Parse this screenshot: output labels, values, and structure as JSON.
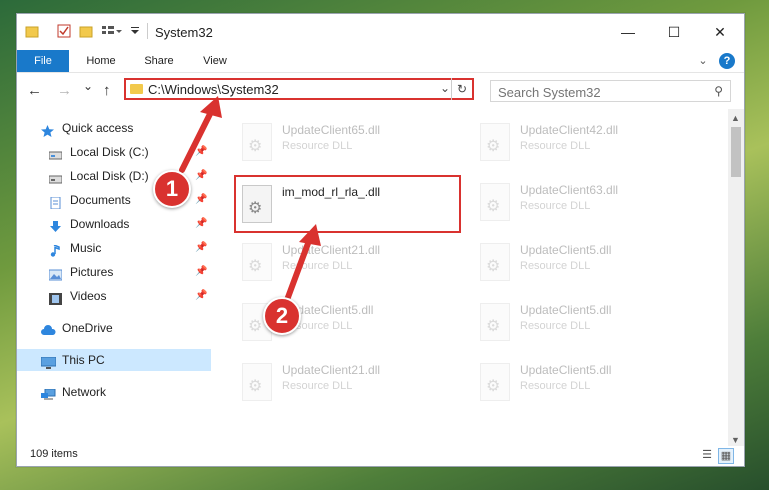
{
  "window": {
    "title": "System32",
    "minimize_glyph": "—",
    "maximize_glyph": "☐",
    "close_glyph": "✕",
    "help_glyph": "?"
  },
  "ribbon": {
    "tabs": [
      {
        "label": "File"
      },
      {
        "label": "Home"
      },
      {
        "label": "Share"
      },
      {
        "label": "View"
      }
    ],
    "expand_glyph": "⌄"
  },
  "nav": {
    "back_glyph": "←",
    "forward_glyph": "→",
    "recent_glyph": "⌄",
    "up_glyph": "↑",
    "address": "C:\\Windows\\System32",
    "address_dropdown_glyph": "⌄",
    "refresh_glyph": "↻",
    "search_placeholder": "Search System32",
    "search_glyph": "⚲"
  },
  "sidebar": {
    "items": [
      {
        "label": "Quick access",
        "icon": "star-icon",
        "color": "#2e86de"
      },
      {
        "label": "Local Disk (C:)",
        "icon": "drive-icon",
        "color": "#666666",
        "pinned": "📌"
      },
      {
        "label": "Local Disk (D:)",
        "icon": "drive-icon",
        "color": "#666666",
        "pinned": "📌"
      },
      {
        "label": "Documents",
        "icon": "documents-icon",
        "color": "#5a8fd6",
        "pinned": "📌"
      },
      {
        "label": "Downloads",
        "icon": "downloads-icon",
        "color": "#2e86de",
        "pinned": "📌"
      },
      {
        "label": "Music",
        "icon": "music-icon",
        "color": "#2e86de",
        "pinned": "📌"
      },
      {
        "label": "Pictures",
        "icon": "pictures-icon",
        "color": "#5a8fd6",
        "pinned": "📌"
      },
      {
        "label": "Videos",
        "icon": "videos-icon",
        "color": "#444444",
        "pinned": "📌"
      },
      {
        "label": "OneDrive",
        "icon": "cloud-icon",
        "color": "#2e86de"
      },
      {
        "label": "This PC",
        "icon": "computer-icon",
        "color": "#5aa0e0",
        "selected": true
      },
      {
        "label": "Network",
        "icon": "network-icon",
        "color": "#2e86de"
      }
    ]
  },
  "files": {
    "left_column": [
      {
        "name": "UpdateClient65.dll",
        "type": "Resource DLL",
        "faded": true
      },
      {
        "name": "im_mod_rl_rla_.dll",
        "type": "",
        "faded": false
      },
      {
        "name": "UpdateClient21.dll",
        "type": "Resource DLL",
        "faded": true
      },
      {
        "name": "UpdateClient5.dll",
        "type": "Resource DLL",
        "faded": true
      },
      {
        "name": "UpdateClient21.dll",
        "type": "Resource DLL",
        "faded": true
      }
    ],
    "right_column": [
      {
        "name": "UpdateClient42.dll",
        "type": "Resource DLL",
        "faded": true
      },
      {
        "name": "UpdateClient63.dll",
        "type": "Resource DLL",
        "faded": true
      },
      {
        "name": "UpdateClient5.dll",
        "type": "Resource DLL",
        "faded": true
      },
      {
        "name": "UpdateClient5.dll",
        "type": "Resource DLL",
        "faded": true
      },
      {
        "name": "UpdateClient5.dll",
        "type": "Resource DLL",
        "faded": true
      }
    ]
  },
  "status": {
    "item_count": "109 items"
  },
  "annotations": {
    "step1": "1",
    "step2": "2",
    "color": "#d9322f"
  }
}
